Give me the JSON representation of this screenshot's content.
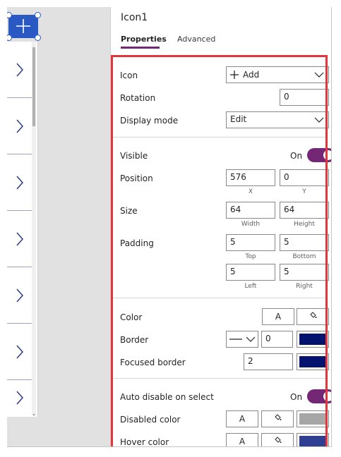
{
  "panel": {
    "title": "Icon1",
    "tabs": [
      {
        "label": "Properties",
        "active": true
      },
      {
        "label": "Advanced",
        "active": false
      }
    ]
  },
  "properties": {
    "icon": {
      "label": "Icon",
      "value": "Add"
    },
    "rotation": {
      "label": "Rotation",
      "value": "0"
    },
    "display_mode": {
      "label": "Display mode",
      "value": "Edit"
    },
    "visible": {
      "label": "Visible",
      "state": "On"
    },
    "position": {
      "label": "Position",
      "x": "576",
      "y": "0",
      "x_caption": "X",
      "y_caption": "Y"
    },
    "size": {
      "label": "Size",
      "width": "64",
      "height": "64",
      "width_caption": "Width",
      "height_caption": "Height"
    },
    "padding": {
      "label": "Padding",
      "top": "5",
      "bottom": "5",
      "left": "5",
      "right": "5",
      "top_caption": "Top",
      "bottom_caption": "Bottom",
      "left_caption": "Left",
      "right_caption": "Right"
    },
    "color": {
      "label": "Color",
      "text_button": "A"
    },
    "border": {
      "label": "Border",
      "width": "0",
      "color": "#03136e"
    },
    "focused_border": {
      "label": "Focused border",
      "width": "2",
      "color": "#03136e"
    },
    "auto_disable": {
      "label": "Auto disable on select",
      "state": "On"
    },
    "disabled_color": {
      "label": "Disabled color",
      "text_button": "A",
      "color": "#a6a6a6"
    },
    "hover_color": {
      "label": "Hover color",
      "text_button": "A",
      "color": "#2e3f92"
    }
  },
  "colors": {
    "accent": "#742774",
    "selection": "#2b59c3",
    "highlight_box": "#e3363b"
  },
  "icons": [
    "add-icon",
    "chevron-right-icon",
    "chevron-down-icon",
    "paint-bucket-icon",
    "line-style-icon"
  ]
}
